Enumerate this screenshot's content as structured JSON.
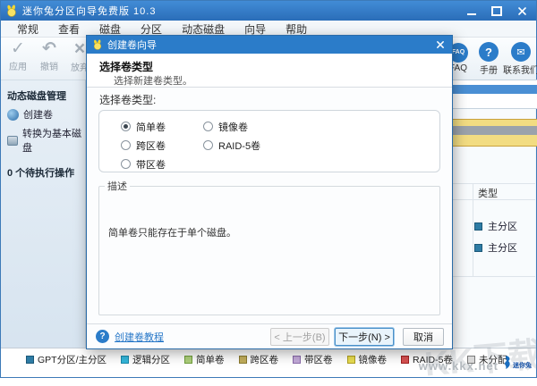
{
  "window": {
    "title": "迷你兔分区向导免费版 10.3"
  },
  "menu": {
    "items": [
      "常规",
      "查看",
      "磁盘",
      "分区",
      "动态磁盘",
      "向导",
      "帮助"
    ]
  },
  "toolbar": {
    "apply": "应用",
    "undo": "撤销",
    "discard": "放弃",
    "faq_glyph": "FAQ",
    "faq": "FAQ",
    "manual": "手册",
    "contact": "联系我们"
  },
  "sidebar": {
    "section_title": "动态磁盘管理",
    "create_volume": "创建卷",
    "convert_basic": "转换为基本磁盘",
    "pending": "0 个待执行操作"
  },
  "main": {
    "type_header": "类型",
    "rows": [
      "主分区",
      "主分区"
    ]
  },
  "dialog": {
    "title": "创建卷向导",
    "heading": "选择卷类型",
    "subheading": "选择新建卷类型。",
    "body_label": "选择卷类型:",
    "options": [
      {
        "label": "简单卷",
        "selected": true
      },
      {
        "label": "镜像卷",
        "selected": false
      },
      {
        "label": "跨区卷",
        "selected": false
      },
      {
        "label": "RAID-5卷",
        "selected": false
      },
      {
        "label": "带区卷",
        "selected": false
      }
    ],
    "description_title": "描述",
    "description_text": "简单卷只能存在于单个磁盘。",
    "help_link": "创建卷教程",
    "buttons": {
      "back": "< 上一步(B)",
      "next": "下一步(N) >",
      "cancel": "取消"
    }
  },
  "legend": {
    "items": [
      {
        "label": "GPT分区/主分区",
        "fill": "#2e7ca5",
        "border": "#1c5878"
      },
      {
        "label": "逻辑分区",
        "fill": "#35b8dc",
        "border": "#1a8aaa"
      },
      {
        "label": "简单卷",
        "fill": "#aed07c",
        "border": "#6f9e3c"
      },
      {
        "label": "跨区卷",
        "fill": "#c2ae5c",
        "border": "#8a7a30"
      },
      {
        "label": "带区卷",
        "fill": "#c3abd9",
        "border": "#8a6aaa"
      },
      {
        "label": "镜像卷",
        "fill": "#e9dd52",
        "border": "#b0a020"
      },
      {
        "label": "RAID-5卷",
        "fill": "#d85252",
        "border": "#a02020"
      },
      {
        "label": "未分配",
        "fill": "#d9d9d9",
        "border": "#7a7a7a"
      }
    ]
  },
  "watermark": {
    "big": "KK下载",
    "site": "www.kkx.net",
    "brand": "迷你兔"
  }
}
